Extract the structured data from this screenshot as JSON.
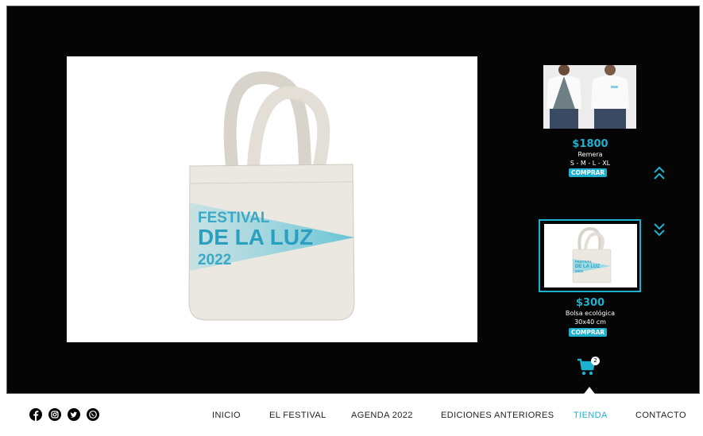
{
  "products": [
    {
      "price": "$1800",
      "name": "Remera",
      "detail": "S - M - L - XL",
      "buy_label": "COMPRAR",
      "image_icon": "tshirt-models-photo"
    },
    {
      "price": "$300",
      "name": "Bolsa ecológica",
      "detail": "30x40 cm",
      "buy_label": "COMPRAR",
      "image_icon": "tote-bag-photo"
    }
  ],
  "feature_image": {
    "print_line1": "FESTIVAL",
    "print_line2": "DE LA LUZ",
    "print_line3": "2022"
  },
  "thumb_print": {
    "line1": "FESTIVAL",
    "line2": "DE LA LUZ",
    "line3": "2022"
  },
  "cart": {
    "count": "2",
    "icon": "cart-icon"
  },
  "social": [
    "facebook-icon",
    "instagram-icon",
    "twitter-icon",
    "whatsapp-icon"
  ],
  "nav": [
    {
      "label": "INICIO"
    },
    {
      "label": "EL FESTIVAL"
    },
    {
      "label": "AGENDA 2022"
    },
    {
      "label": "EDICIONES ANTERIORES"
    },
    {
      "label": "TIENDA",
      "active": true
    },
    {
      "label": "CONTACTO"
    }
  ],
  "colors": {
    "accent": "#1eb0cf",
    "background": "#050505"
  }
}
